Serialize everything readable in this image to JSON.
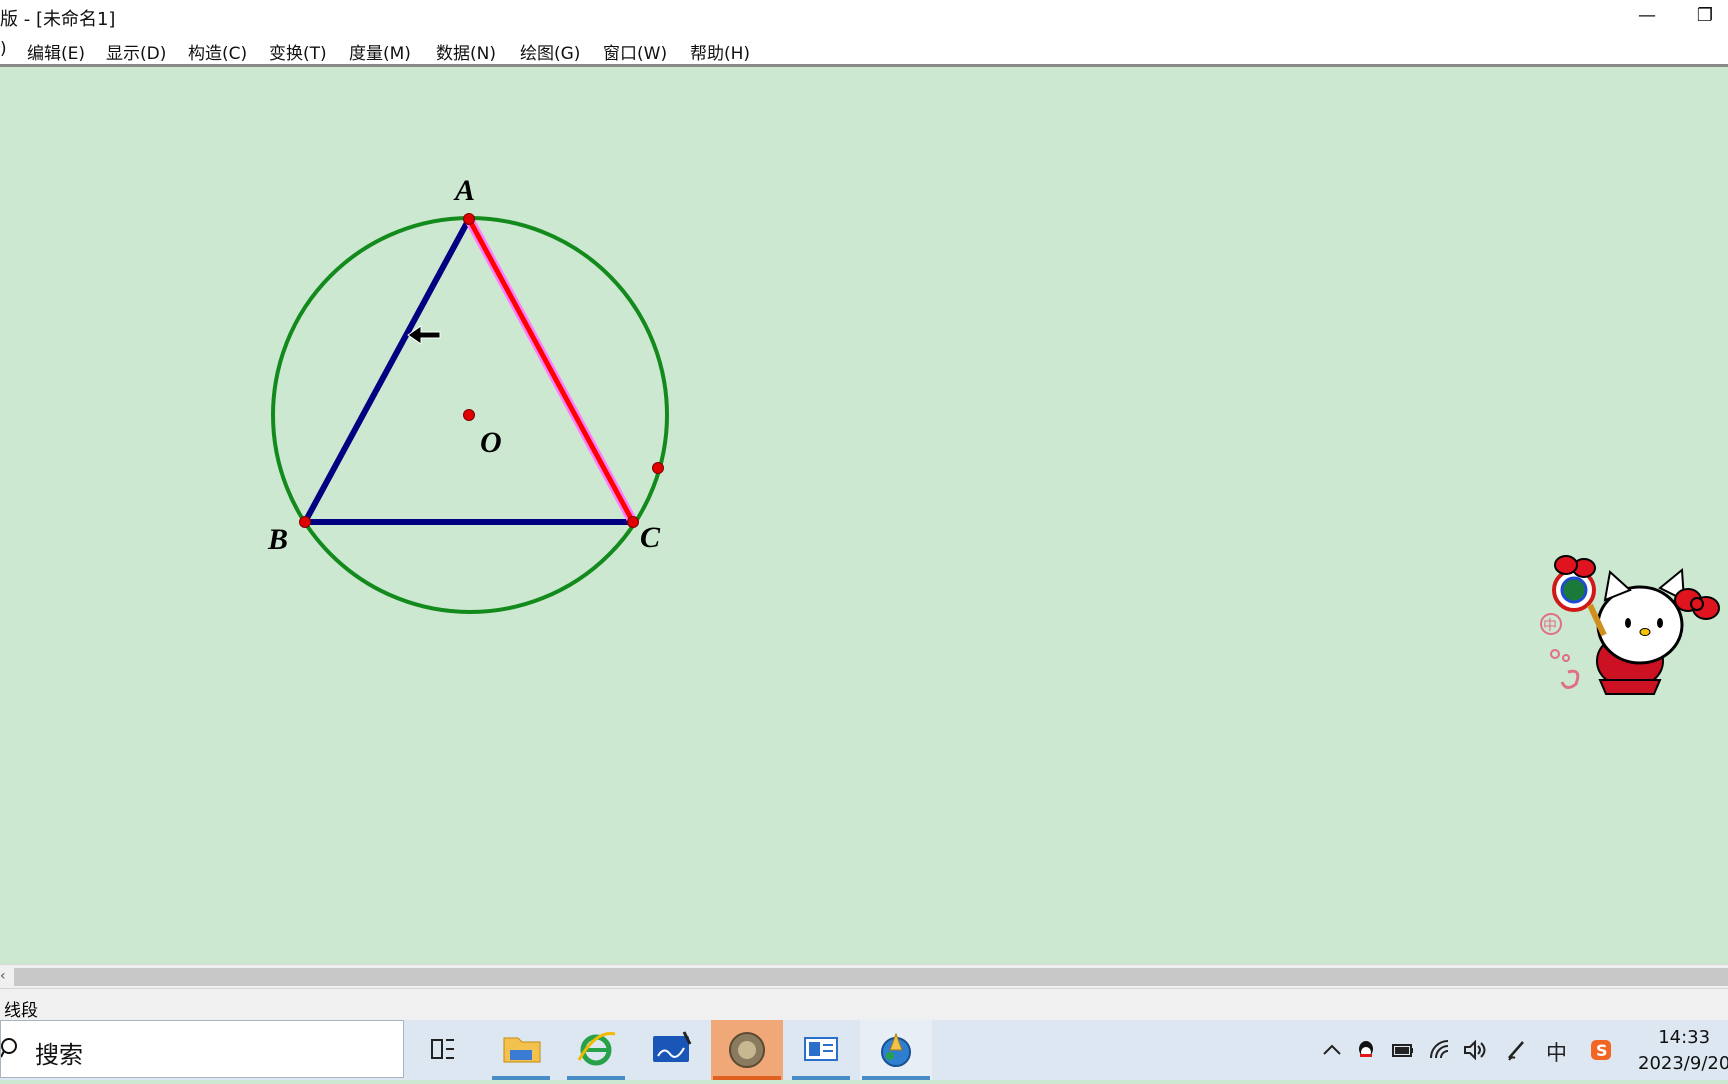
{
  "window": {
    "title": "版 - [未命名1]",
    "minimize_glyph": "—",
    "restore_glyph": "❐"
  },
  "menu": {
    "items": [
      {
        "label": ")"
      },
      {
        "label": "编辑(E)"
      },
      {
        "label": "显示(D)"
      },
      {
        "label": "构造(C)"
      },
      {
        "label": "变换(T)"
      },
      {
        "label": "度量(M)"
      },
      {
        "label": "数据(N)"
      },
      {
        "label": "绘图(G)"
      },
      {
        "label": "窗口(W)"
      },
      {
        "label": "帮助(H)"
      }
    ]
  },
  "sketch": {
    "points": {
      "A": "A",
      "B": "B",
      "C": "C",
      "O": "O"
    },
    "colors": {
      "circle": "#138a1c",
      "segment_ab_bc": "#000080",
      "segment_ac": "#ff0000",
      "segment_ac_highlight": "#ff80ff",
      "point": "#e00000",
      "background": "#cce8d1"
    }
  },
  "statusbar": {
    "text": "线段"
  },
  "taskbar": {
    "search_placeholder": "搜索",
    "apps": [
      {
        "icon": "task-view-icon"
      },
      {
        "icon": "file-explorer-icon"
      },
      {
        "icon": "internet-explorer-icon"
      },
      {
        "icon": "whiteboard-icon"
      },
      {
        "icon": "photo-app-icon"
      },
      {
        "icon": "presentation-app-icon"
      },
      {
        "icon": "geometers-sketchpad-icon"
      }
    ],
    "tray": [
      {
        "icon": "chevron-up-icon"
      },
      {
        "icon": "qq-icon"
      },
      {
        "icon": "battery-icon"
      },
      {
        "icon": "wifi-icon"
      },
      {
        "icon": "volume-icon"
      },
      {
        "icon": "pen-icon"
      },
      {
        "icon": "input-method-icon",
        "label": "中"
      },
      {
        "icon": "sogou-ime-icon"
      }
    ],
    "time": "14:33",
    "date": "2023/9/20"
  }
}
